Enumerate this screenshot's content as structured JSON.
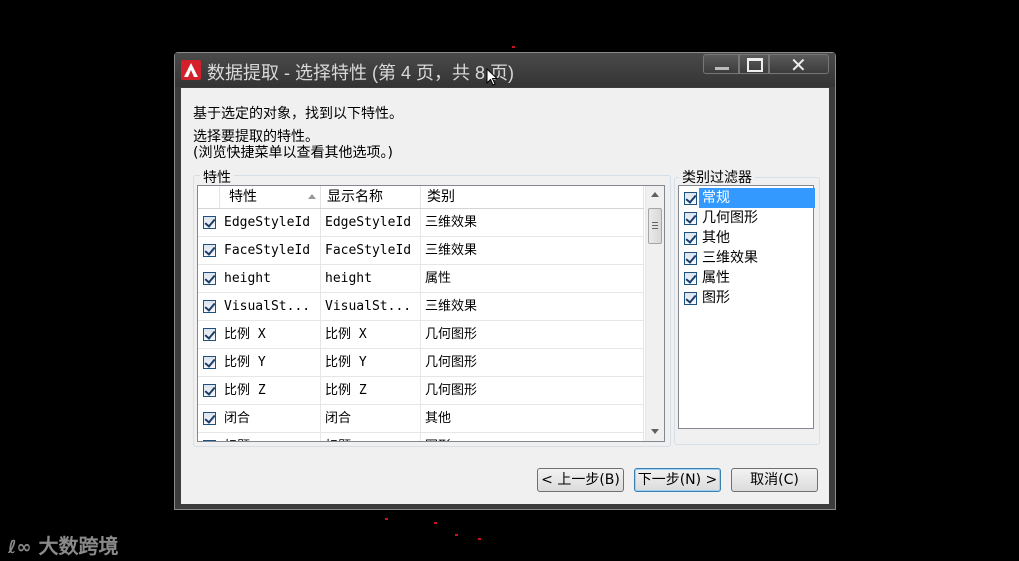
{
  "window": {
    "title": "数据提取 - 选择特性 (第 4 页，共 8 页)",
    "intro_line1": "基于选定的对象，找到以下特性。",
    "intro_line2": "选择要提取的特性。",
    "intro_line3": "(浏览快捷菜单以查看其他选项。)"
  },
  "properties_group": {
    "label": "特性",
    "columns": [
      "特性",
      "显示名称",
      "类别"
    ],
    "rows": [
      {
        "checked": true,
        "property": "EdgeStyleId",
        "display_name": "EdgeStyleId",
        "category": "三维效果"
      },
      {
        "checked": true,
        "property": "FaceStyleId",
        "display_name": "FaceStyleId",
        "category": "三维效果"
      },
      {
        "checked": true,
        "property": "height",
        "display_name": "height",
        "category": "属性"
      },
      {
        "checked": true,
        "property": "VisualSt...",
        "display_name": "VisualSt...",
        "category": "三维效果"
      },
      {
        "checked": true,
        "property": "比例 X",
        "display_name": "比例 X",
        "category": "几何图形"
      },
      {
        "checked": true,
        "property": "比例 Y",
        "display_name": "比例 Y",
        "category": "几何图形"
      },
      {
        "checked": true,
        "property": "比例 Z",
        "display_name": "比例 Z",
        "category": "几何图形"
      },
      {
        "checked": true,
        "property": "闭合",
        "display_name": "闭合",
        "category": "其他"
      },
      {
        "checked": true,
        "property": "标题",
        "display_name": "标题",
        "category": "图形"
      }
    ]
  },
  "category_filter": {
    "label": "类别过滤器",
    "items": [
      {
        "label": "常规",
        "checked": true,
        "selected": true
      },
      {
        "label": "几何图形",
        "checked": true,
        "selected": false
      },
      {
        "label": "其他",
        "checked": true,
        "selected": false
      },
      {
        "label": "三维效果",
        "checked": true,
        "selected": false
      },
      {
        "label": "属性",
        "checked": true,
        "selected": false
      },
      {
        "label": "图形",
        "checked": true,
        "selected": false
      }
    ]
  },
  "buttons": {
    "back": "< 上一步(B)",
    "next": "下一步(N) >",
    "cancel": "取消(C)"
  },
  "watermark": "大数跨境",
  "colors": {
    "selection": "#3399ff",
    "app_icon": "#d4202a",
    "titlebar": "#3c3c3c"
  }
}
